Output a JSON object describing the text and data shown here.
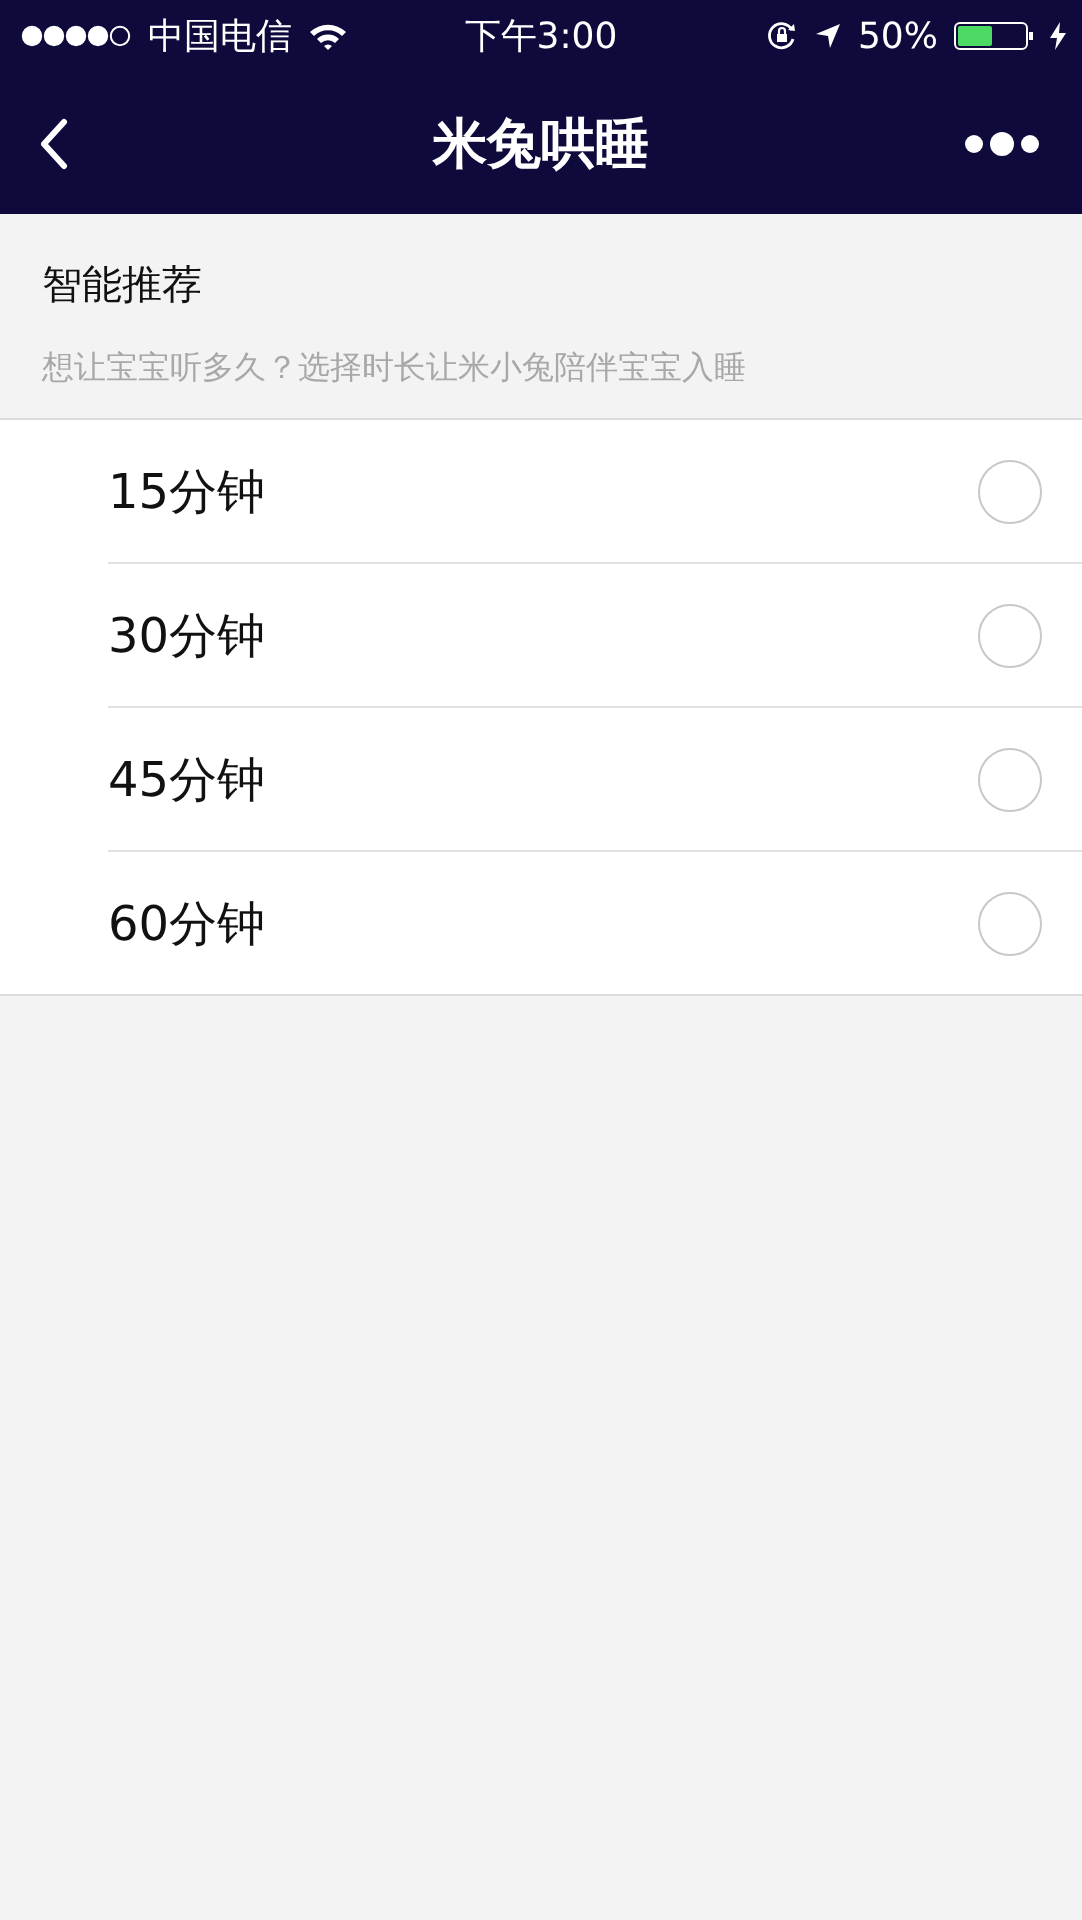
{
  "status_bar": {
    "carrier": "中国电信",
    "time": "下午3:00",
    "battery": "50%"
  },
  "nav": {
    "title": "米兔哄睡"
  },
  "section": {
    "title": "智能推荐",
    "hint": "想让宝宝听多久？选择时长让米小兔陪伴宝宝入睡"
  },
  "options": [
    {
      "label": "15分钟",
      "selected": false
    },
    {
      "label": "30分钟",
      "selected": false
    },
    {
      "label": "45分钟",
      "selected": false
    },
    {
      "label": "60分钟",
      "selected": false
    }
  ]
}
